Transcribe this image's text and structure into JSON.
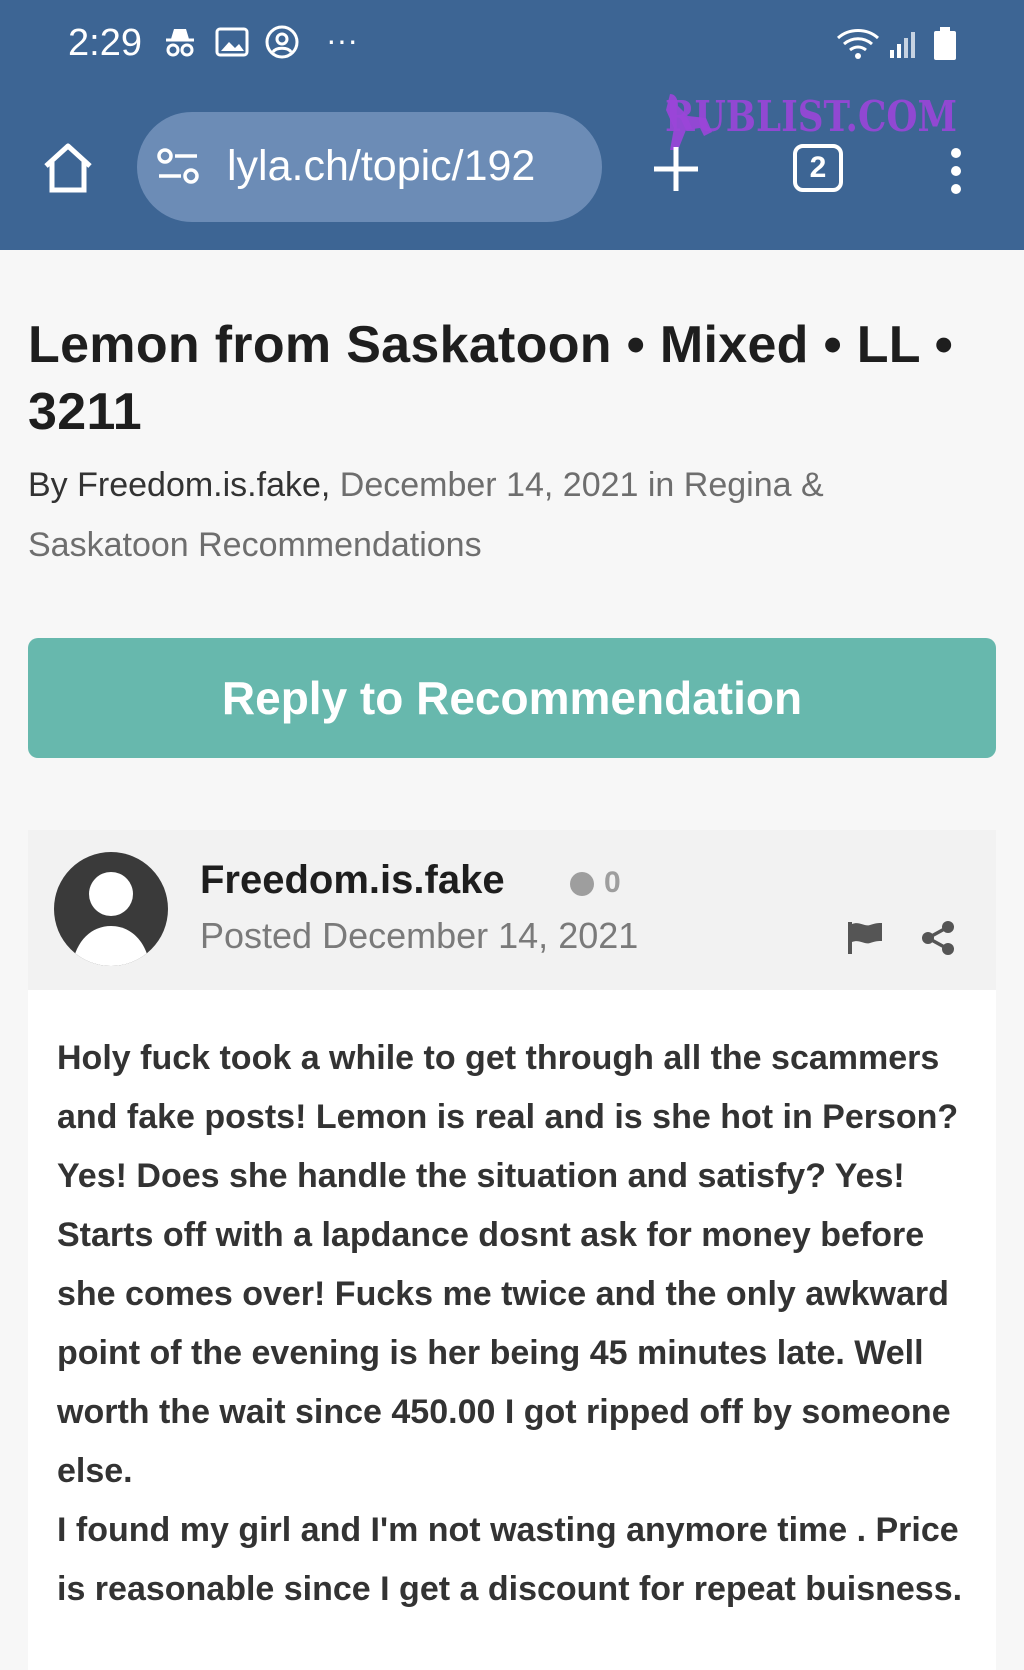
{
  "status_bar": {
    "time": "2:29",
    "more": "···"
  },
  "browser": {
    "url": "lyla.ch/topic/192",
    "tab_count": "2",
    "watermark": "RUBLIST.COM"
  },
  "topic": {
    "title": "Lemon from Saskatoon • Mixed • LL • 3211",
    "by_prefix": "By ",
    "author": "Freedom.is.fake,",
    "date": " December 14, 2021",
    "in_text": " in ",
    "forum": "Regina & Saskatoon Recommendations"
  },
  "reply_button": {
    "label": "Reply to Recommendation"
  },
  "post": {
    "author": "Freedom.is.fake",
    "reputation": "0",
    "posted": "Posted December 14, 2021",
    "paragraph1": "Holy fuck took a while to get through all the scammers and fake posts! Lemon is real and is she hot in Person? Yes! Does she handle the situation and satisfy? Yes! Starts off with a lapdance dosnt ask for money before she comes over! Fucks me twice and the only awkward point of the evening is her being 45 minutes late. Well worth the wait since 450.00 I got ripped off by someone else.",
    "paragraph2": "I found my girl and I'm not wasting anymore time . Price is reasonable since I get a discount for repeat buisness."
  },
  "colors": {
    "chrome_bg": "#3d6594",
    "urlbar_bg": "#6c8cb6",
    "accent": "#67b8ad",
    "watermark": "#9b45d9"
  }
}
